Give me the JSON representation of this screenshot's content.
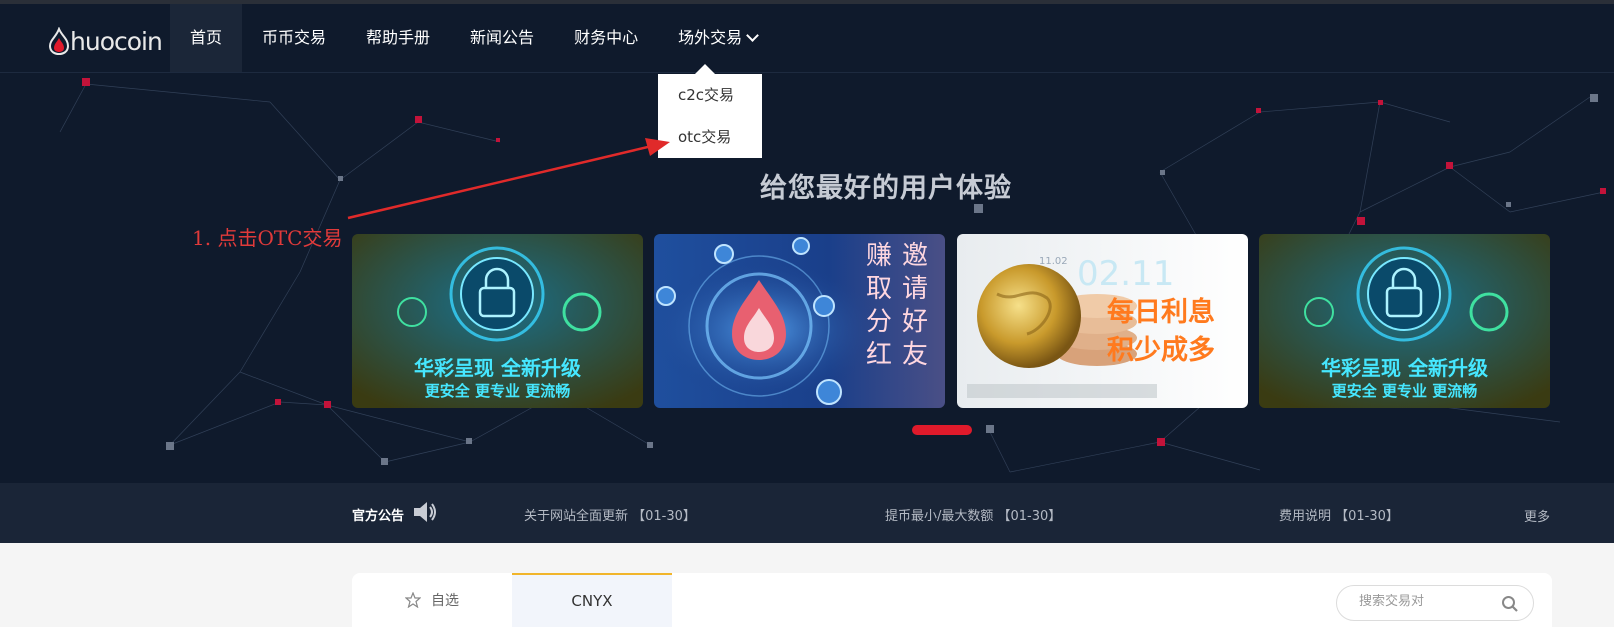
{
  "brand": {
    "logo_text": "huocoin",
    "accent": "#e01a2b"
  },
  "nav": {
    "items": [
      {
        "label": "首页",
        "active": true
      },
      {
        "label": "币币交易"
      },
      {
        "label": "帮助手册"
      },
      {
        "label": "新闻公告"
      },
      {
        "label": "财务中心"
      },
      {
        "label": "场外交易",
        "has_dropdown": true
      }
    ]
  },
  "dropdown": {
    "items": [
      "c2c交易",
      "otc交易"
    ]
  },
  "annotation": {
    "text": "1. 点击OTC交易",
    "color": "#e03a3a"
  },
  "hero": {
    "title": "给您最好的用户体验",
    "banners": [
      {
        "line1": "华彩呈现 全新升级",
        "line2": "更安全 更专业 更流畅"
      },
      {
        "col1": "邀请好友",
        "col2": "赚取分红"
      },
      {
        "date": "02.11",
        "date_small": "11.02",
        "line1": "每日利息",
        "line2": "积少成多"
      },
      {
        "line1": "华彩呈现 全新升级",
        "line2": "更安全 更专业 更流畅"
      }
    ]
  },
  "notice": {
    "title": "官方公告",
    "items": [
      "关于网站全面更新 【01-30】",
      "提币最小/最大数额 【01-30】",
      "费用说明 【01-30】"
    ],
    "more": "更多"
  },
  "market": {
    "tabs": [
      {
        "label": "自选",
        "icon": "star-icon"
      },
      {
        "label": "CNYX",
        "active": true
      }
    ],
    "search_placeholder": "搜索交易对"
  }
}
